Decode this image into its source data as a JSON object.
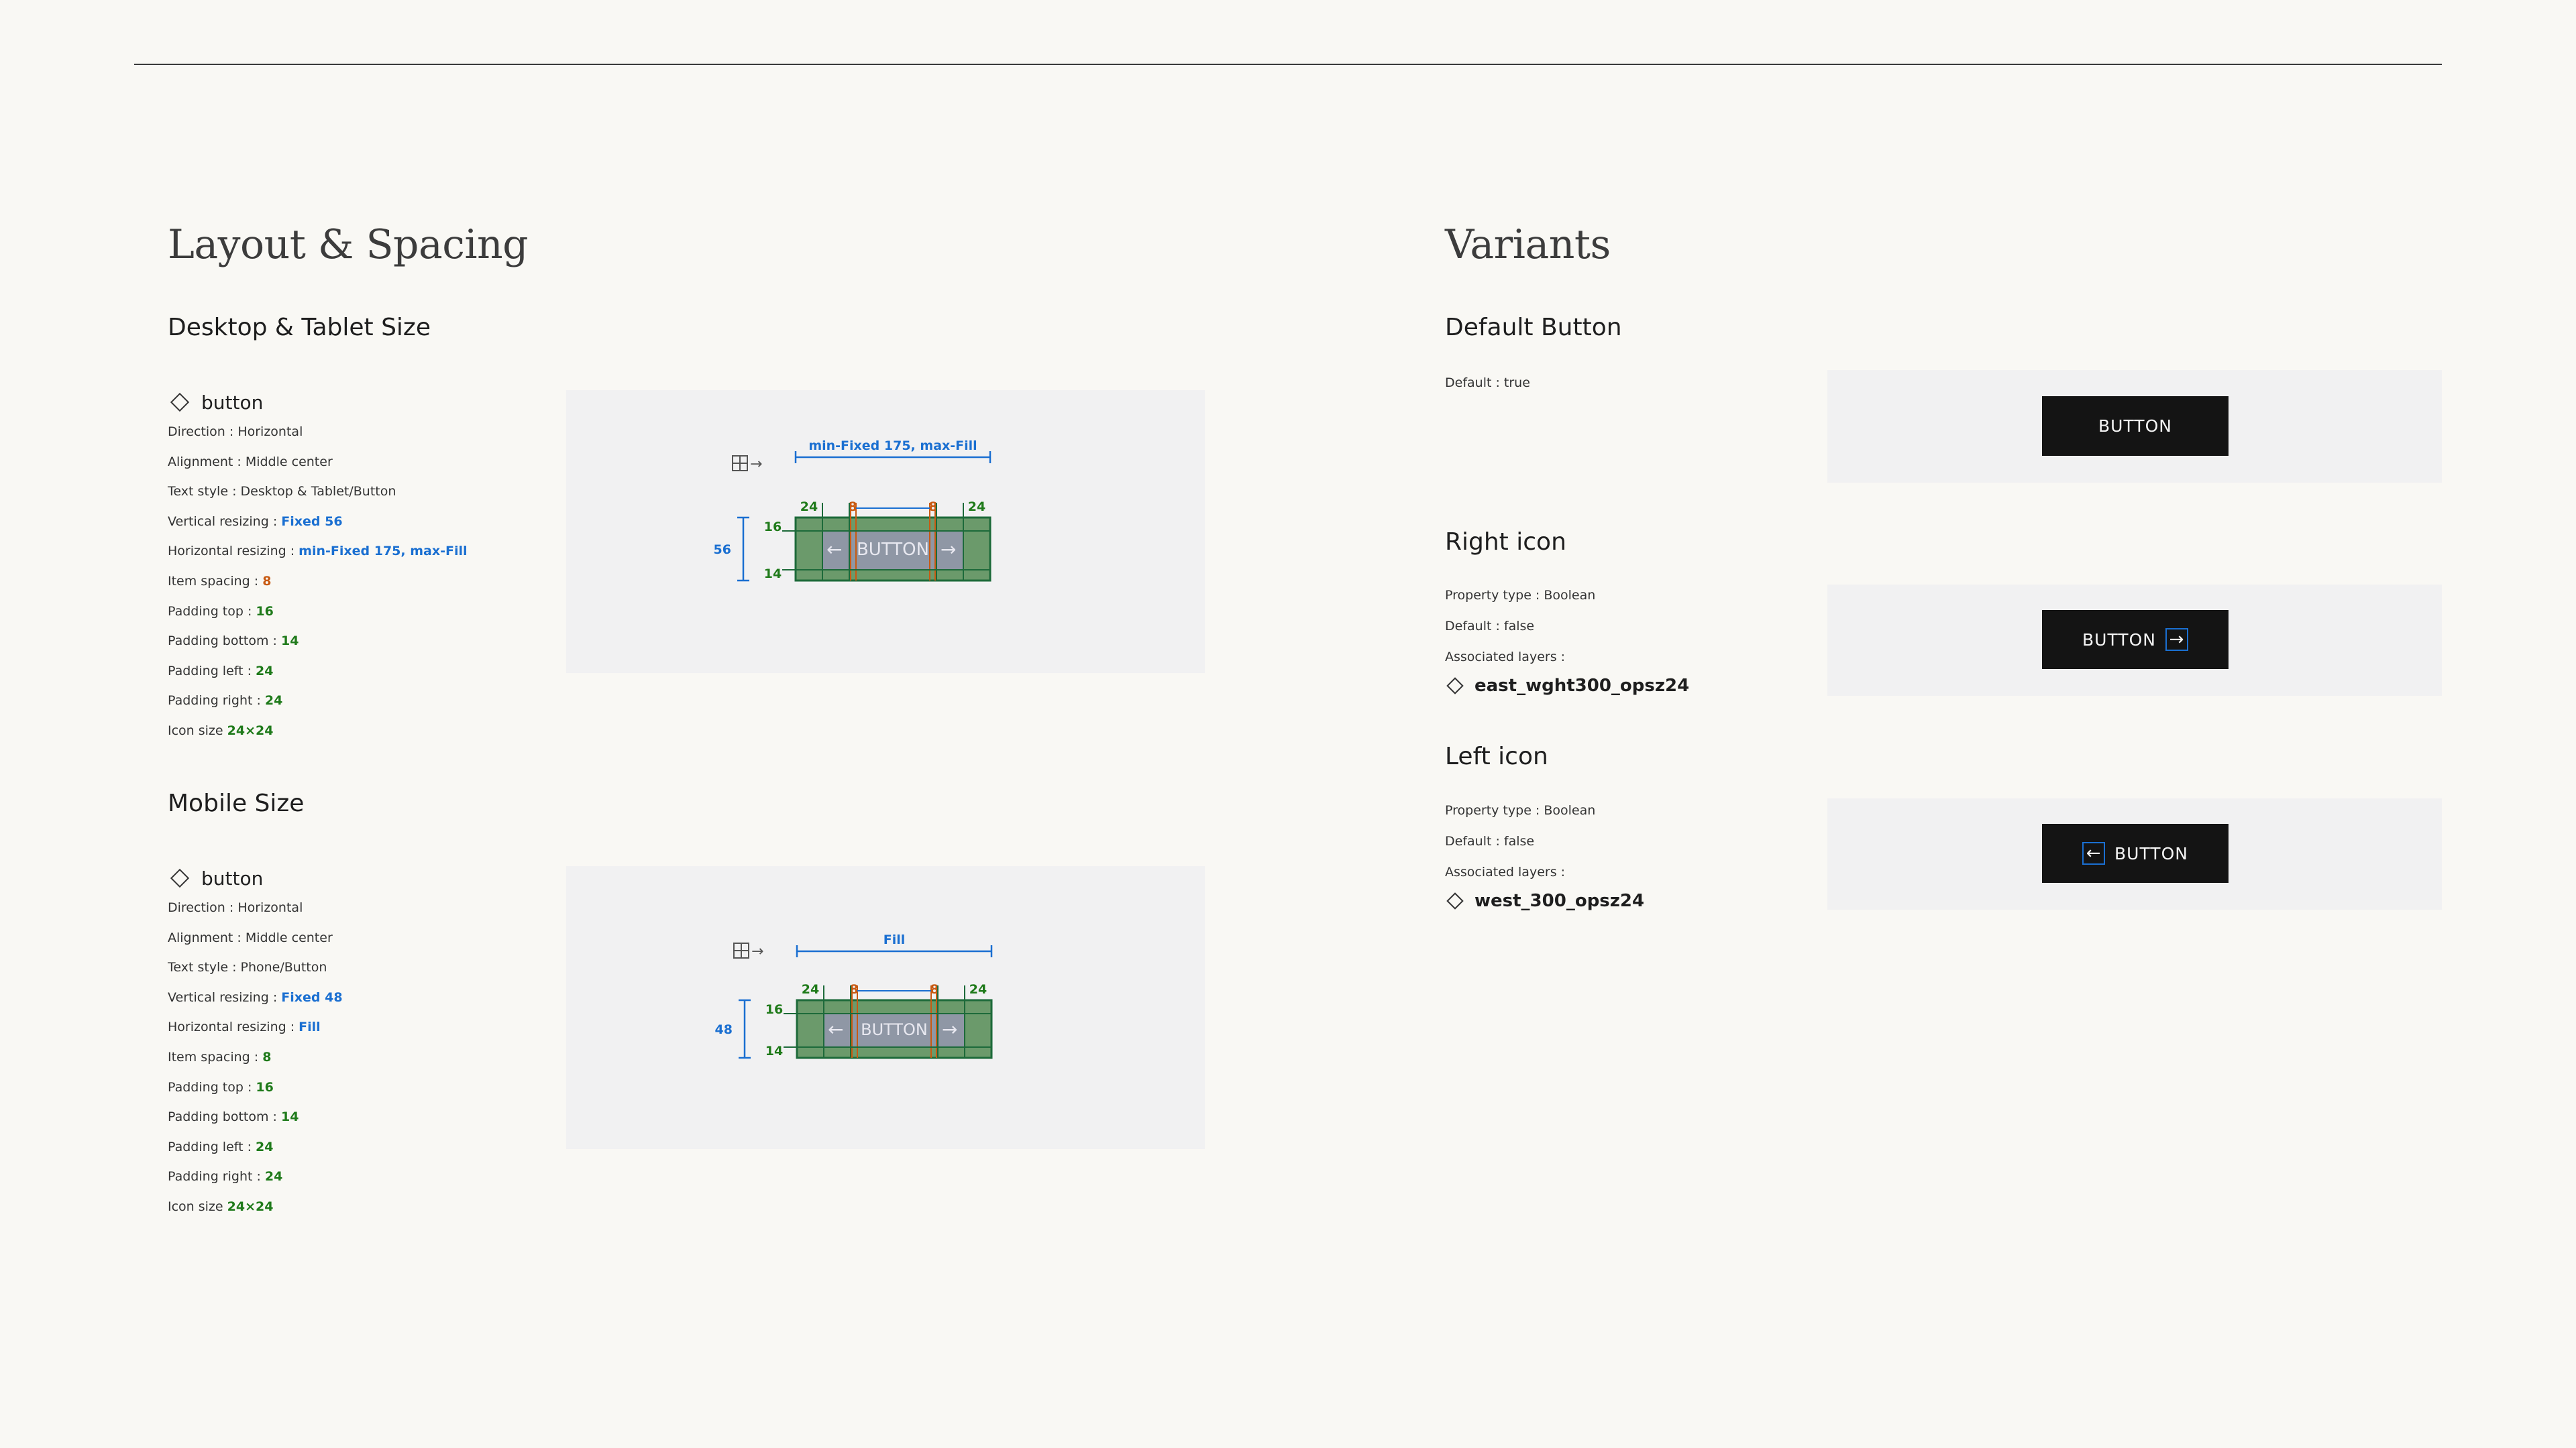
{
  "layout_section": {
    "title": "Layout & Spacing",
    "desktop": {
      "heading": "Desktop & Tablet Size",
      "component": "button",
      "props": [
        {
          "label": "Direction : ",
          "value": "Horizontal",
          "style": "plain"
        },
        {
          "label": "Alignment : ",
          "value": "Middle center",
          "style": "plain"
        },
        {
          "label": "Text style : ",
          "value": "Desktop & Tablet/Button",
          "style": "plain"
        },
        {
          "label": "Vertical resizing : ",
          "value": "Fixed 56",
          "style": "blue"
        },
        {
          "label": "Horizontal resizing : ",
          "value": "min-Fixed 175, max-Fill",
          "style": "blue"
        },
        {
          "label": "Item spacing : ",
          "value": "8",
          "style": "orange"
        },
        {
          "label": "Padding top : ",
          "value": "16",
          "style": "green"
        },
        {
          "label": "Padding bottom : ",
          "value": "14",
          "style": "green"
        },
        {
          "label": "Padding left : ",
          "value": "24",
          "style": "green"
        },
        {
          "label": "Padding right : ",
          "value": "24",
          "style": "green"
        },
        {
          "label": "Icon size ",
          "value": "24×24",
          "style": "green"
        }
      ],
      "diagram": {
        "width_label": "min-Fixed 175, max-Fill",
        "height_label": "56",
        "pad_top": "16",
        "pad_bottom": "14",
        "pad_left": "24",
        "pad_right": "24",
        "spacing_left": "8",
        "spacing_right": "8",
        "button_text": "BUTTON"
      }
    },
    "mobile": {
      "heading": "Mobile Size",
      "component": "button",
      "props": [
        {
          "label": "Direction : ",
          "value": "Horizontal",
          "style": "plain"
        },
        {
          "label": "Alignment : ",
          "value": "Middle center",
          "style": "plain"
        },
        {
          "label": "Text style : ",
          "value": "Phone/Button",
          "style": "plain"
        },
        {
          "label": "Vertical resizing : ",
          "value": "Fixed 48",
          "style": "blue"
        },
        {
          "label": "Horizontal resizing : ",
          "value": "Fill",
          "style": "blue"
        },
        {
          "label": "Item spacing : ",
          "value": "8",
          "style": "green"
        },
        {
          "label": "Padding top : ",
          "value": "16",
          "style": "green"
        },
        {
          "label": "Padding bottom : ",
          "value": "14",
          "style": "green"
        },
        {
          "label": "Padding left : ",
          "value": "24",
          "style": "green"
        },
        {
          "label": "Padding right : ",
          "value": "24",
          "style": "green"
        },
        {
          "label": "Icon size ",
          "value": "24×24",
          "style": "green"
        }
      ],
      "diagram": {
        "width_label": "Fill",
        "height_label": "48",
        "pad_top": "16",
        "pad_bottom": "14",
        "pad_left": "24",
        "pad_right": "24",
        "spacing_left": "8",
        "spacing_right": "8",
        "button_text": "BUTTON"
      }
    }
  },
  "variants_section": {
    "title": "Variants",
    "default": {
      "heading": "Default Button",
      "props": [
        "Default : true"
      ],
      "button_label": "BUTTON"
    },
    "right_icon": {
      "heading": "Right icon",
      "props": [
        "Property type : Boolean",
        "Default : false",
        "Associated layers :"
      ],
      "layer": "east_wght300_opsz24",
      "button_label": "BUTTON",
      "icon": "arrow-right-icon"
    },
    "left_icon": {
      "heading": "Left icon",
      "props": [
        "Property type : Boolean",
        "Default : false",
        "Associated layers :"
      ],
      "layer": "west_300_opsz24",
      "button_label": "BUTTON",
      "icon": "arrow-left-icon"
    }
  },
  "colors": {
    "background": "#f9f8f4",
    "panel": "#f1f1f2",
    "button": "#141414",
    "measure_blue": "#1a6fd1",
    "padding_green": "#1f7a1a",
    "spacing_orange": "#c85a12"
  }
}
